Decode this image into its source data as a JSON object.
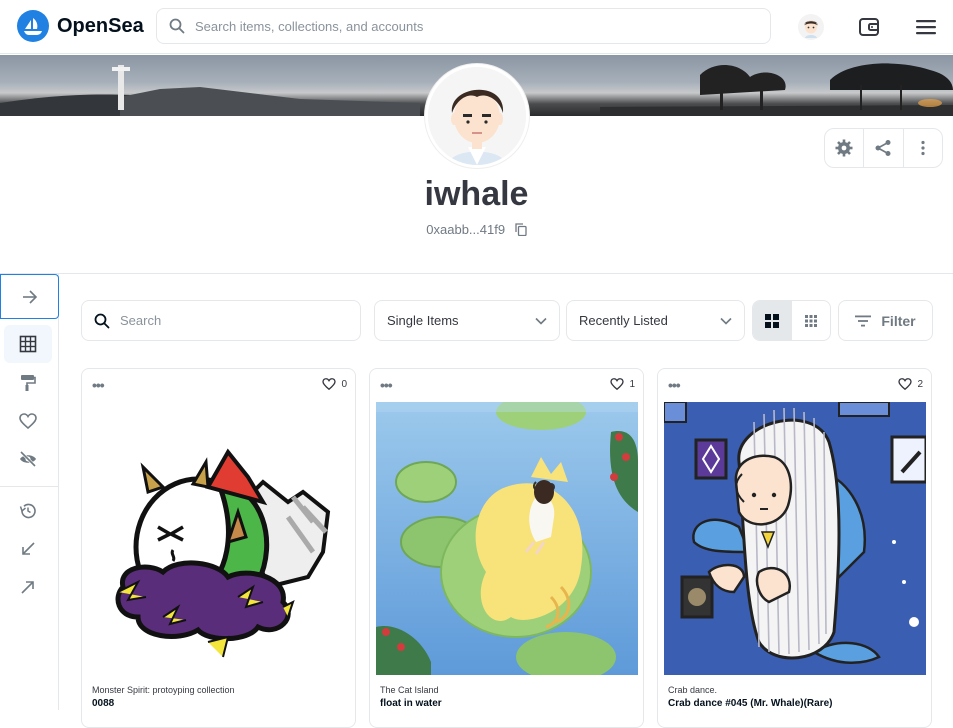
{
  "header": {
    "brand": "OpenSea",
    "search_placeholder": "Search items, collections, and accounts"
  },
  "profile": {
    "username": "iwhale",
    "address": "0xaabb...41f9"
  },
  "toolbar": {
    "search_placeholder": "Search",
    "type_select": "Single Items",
    "sort_select": "Recently Listed",
    "filter_label": "Filter"
  },
  "cards": [
    {
      "collection": "Monster Spirit: protoyping collection",
      "name": "0088",
      "likes": "0"
    },
    {
      "collection": "The Cat Island",
      "name": "float in water",
      "likes": "1"
    },
    {
      "collection": "Crab dance.",
      "name": "Crab dance #045 (Mr. Whale)(Rare)",
      "likes": "2"
    }
  ],
  "colors": {
    "brand_blue": "#2081e2",
    "border": "#e5e8eb",
    "text_muted": "#707a83"
  }
}
